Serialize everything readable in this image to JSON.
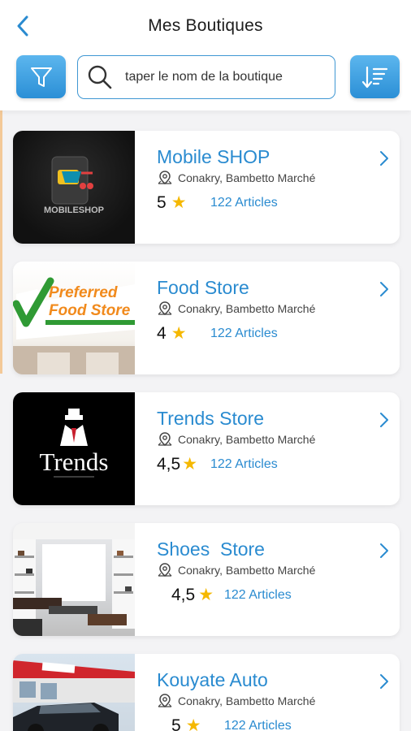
{
  "header": {
    "title": "Mes Boutiques",
    "search_placeholder": "taper le nom de la boutique"
  },
  "colors": {
    "accent": "#2a8bd0",
    "button_gradient_top": "#5cb6ee",
    "button_gradient_bottom": "#2b8fd6",
    "star": "#f5b800"
  },
  "icons": [
    "chevron-left-icon",
    "filter-icon",
    "search-icon",
    "sort-icon",
    "location-pin-icon",
    "star-icon",
    "chevron-right-icon"
  ],
  "shops": [
    {
      "name": "Mobile SHOP",
      "location": "Conakry, Bambetto Marché",
      "rating": "5",
      "articles": "122 Articles",
      "logo_text": "MOBILESHOP"
    },
    {
      "name": "Food Store",
      "location": "Conakry, Bambetto Marché",
      "rating": "4",
      "articles": "122 Articles",
      "logo_text_1": "Preferred",
      "logo_text_2": "Food Store"
    },
    {
      "name": "Trends Store",
      "location": "Conakry, Bambetto Marché",
      "rating": "4,5",
      "articles": "122 Articles",
      "logo_text": "Trends"
    },
    {
      "name": "Shoes  Store",
      "location": "Conakry, Bambetto Marché",
      "rating": "4,5",
      "articles": "122 Articles"
    },
    {
      "name": "Kouyate Auto",
      "location": "Conakry, Bambetto Marché",
      "rating": "5",
      "articles": "122 Articles"
    }
  ]
}
